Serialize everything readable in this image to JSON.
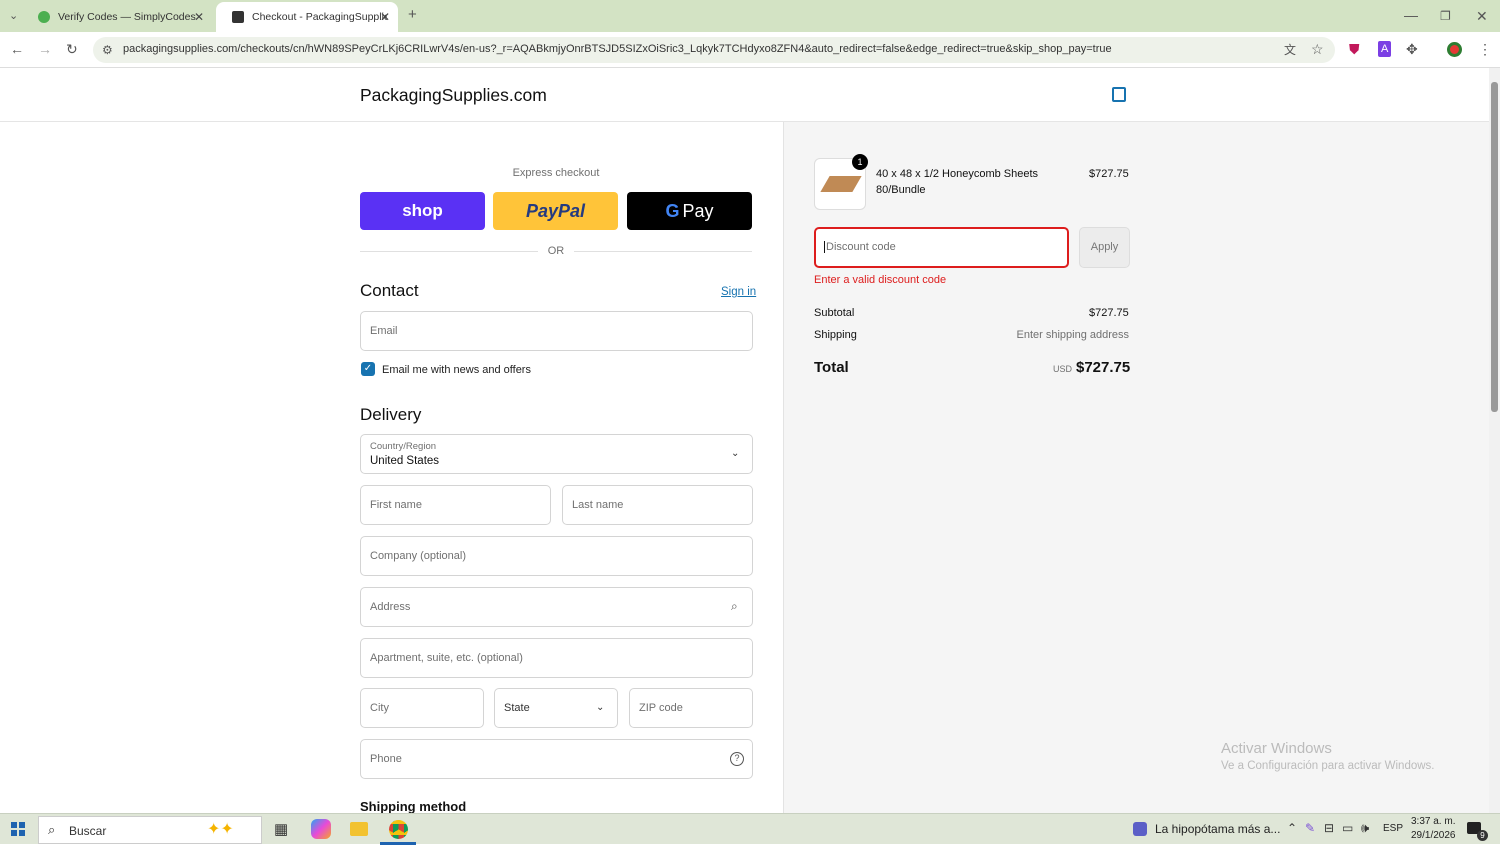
{
  "browser": {
    "tabs": [
      {
        "title": "Verify Codes — SimplyCodes",
        "active": false
      },
      {
        "title": "Checkout - PackagingSupplies.com",
        "active": true
      }
    ],
    "url": "packagingsupplies.com/checkouts/cn/hWN89SPeyCrLKj6CRILwrV4s/en-us?_r=AQABkmjyOnrBTSJD5SIZxOiSric3_Lqkyk7TCHdyxo8ZFN4&auto_redirect=false&edge_redirect=true&skip_shop_pay=true"
  },
  "store": {
    "name": "PackagingSupplies.com"
  },
  "express": {
    "heading": "Express checkout",
    "shop_label": "shop",
    "paypal_label": "PayPal",
    "gpay_label": "Pay",
    "or": "OR",
    "colors": {
      "shop": "#5a31f4",
      "paypal": "#ffc439",
      "gpay": "#000000"
    }
  },
  "contact": {
    "title": "Contact",
    "sign_in": "Sign in",
    "email_placeholder": "Email",
    "newsletter_label": "Email me with news and offers",
    "newsletter_checked": true
  },
  "delivery": {
    "title": "Delivery",
    "country_label": "Country/Region",
    "country_value": "United States",
    "first_name": "First name",
    "last_name": "Last name",
    "company": "Company (optional)",
    "address": "Address",
    "apartment": "Apartment, suite, etc. (optional)",
    "city": "City",
    "state": "State",
    "zip": "ZIP code",
    "phone": "Phone"
  },
  "shipping_method": {
    "title": "Shipping method"
  },
  "order": {
    "item": {
      "qty": "1",
      "name_line1": "40 x 48 x 1/2 Honeycomb Sheets",
      "name_line2": "80/Bundle",
      "price": "$727.75"
    },
    "discount_placeholder": "Discount code",
    "apply_label": "Apply",
    "discount_error": "Enter a valid discount code",
    "subtotal_label": "Subtotal",
    "subtotal_value": "$727.75",
    "shipping_label": "Shipping",
    "shipping_value": "Enter shipping address",
    "total_label": "Total",
    "currency": "USD",
    "total_value": "$727.75",
    "error_color": "#dd1d1d"
  },
  "watermark": {
    "line1": "Activar Windows",
    "line2": "Ve a Configuración para activar Windows."
  },
  "taskbar": {
    "search_placeholder": "Buscar",
    "media_title": "La hipopótama más a...",
    "language": "ESP",
    "time": "3:37 a. m.",
    "date": "29/1/2026",
    "notification_count": "9"
  }
}
